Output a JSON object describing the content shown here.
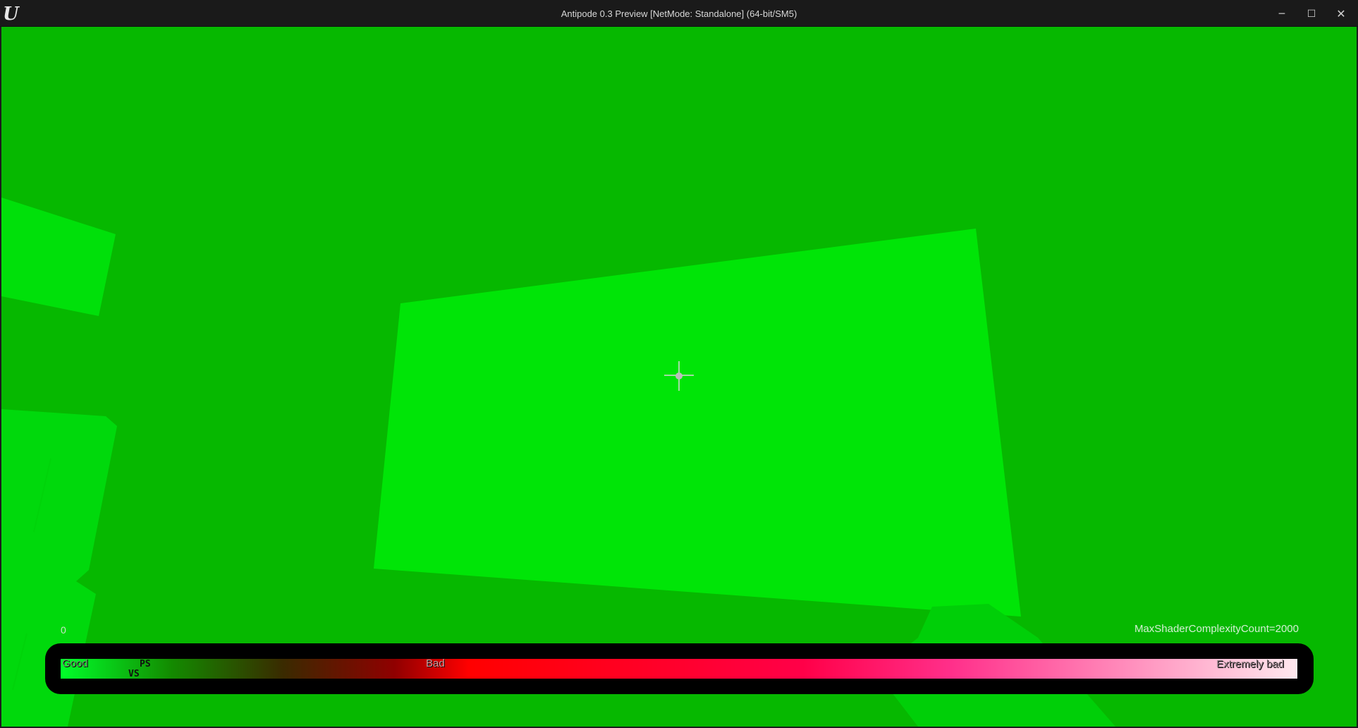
{
  "window": {
    "title": "Antipode 0.3 Preview [NetMode: Standalone]  (64-bit/SM5)",
    "logo_glyph": "U",
    "controls": {
      "minimize_glyph": "─",
      "maximize_glyph": "☐",
      "close_glyph": "✕"
    }
  },
  "viewport": {
    "view_mode": "Shader Complexity",
    "background_color": "#06b800",
    "counter_label": "0",
    "max_count_label": "MaxShaderComplexityCount=2000"
  },
  "complexity_bar": {
    "good_label": "Good",
    "bad_label": "Bad",
    "extreme_label": "Extremely bad",
    "ps_marker": "PS",
    "vs_marker": "VS",
    "gradient_colors": [
      "#00ff2a",
      "#138a00",
      "#3a2a00",
      "#900000",
      "#ff0000",
      "#ff0048",
      "#ff2f8a",
      "#ffb3d0",
      "#ffe8ee"
    ]
  },
  "icons": {
    "logo": "unreal-engine-logo-icon",
    "crosshair": "crosshair-icon"
  }
}
